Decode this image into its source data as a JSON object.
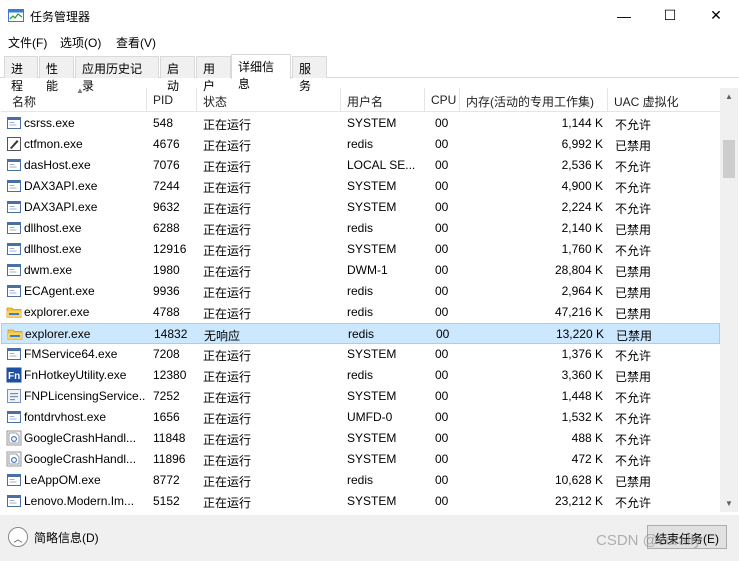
{
  "window": {
    "title": "任务管理器",
    "minimize": "—",
    "maximize": "☐",
    "close": "✕"
  },
  "menu": [
    "文件(F)",
    "选项(O)",
    "查看(V)"
  ],
  "tabs": [
    "进程",
    "性能",
    "应用历史记录",
    "启动",
    "用户",
    "详细信息",
    "服务"
  ],
  "active_tab": "详细信息",
  "columns": [
    "名称",
    "PID",
    "状态",
    "用户名",
    "CPU",
    "内存(活动的专用工作集)",
    "UAC 虚拟化"
  ],
  "rows": [
    {
      "name": "csrss.exe",
      "pid": "548",
      "status": "正在运行",
      "user": "SYSTEM",
      "cpu": "00",
      "mem": "1,144 K",
      "uac": "不允许",
      "icon": "generic-exe-icon"
    },
    {
      "name": "ctfmon.exe",
      "pid": "4676",
      "status": "正在运行",
      "user": "redis",
      "cpu": "00",
      "mem": "6,992 K",
      "uac": "已禁用",
      "icon": "pen-icon"
    },
    {
      "name": "dasHost.exe",
      "pid": "7076",
      "status": "正在运行",
      "user": "LOCAL SE...",
      "cpu": "00",
      "mem": "2,536 K",
      "uac": "不允许",
      "icon": "generic-exe-icon"
    },
    {
      "name": "DAX3API.exe",
      "pid": "7244",
      "status": "正在运行",
      "user": "SYSTEM",
      "cpu": "00",
      "mem": "4,900 K",
      "uac": "不允许",
      "icon": "generic-exe-icon"
    },
    {
      "name": "DAX3API.exe",
      "pid": "9632",
      "status": "正在运行",
      "user": "SYSTEM",
      "cpu": "00",
      "mem": "2,224 K",
      "uac": "不允许",
      "icon": "generic-exe-icon"
    },
    {
      "name": "dllhost.exe",
      "pid": "6288",
      "status": "正在运行",
      "user": "redis",
      "cpu": "00",
      "mem": "2,140 K",
      "uac": "已禁用",
      "icon": "generic-exe-icon"
    },
    {
      "name": "dllhost.exe",
      "pid": "12916",
      "status": "正在运行",
      "user": "SYSTEM",
      "cpu": "00",
      "mem": "1,760 K",
      "uac": "不允许",
      "icon": "generic-exe-icon"
    },
    {
      "name": "dwm.exe",
      "pid": "1980",
      "status": "正在运行",
      "user": "DWM-1",
      "cpu": "00",
      "mem": "28,804 K",
      "uac": "已禁用",
      "icon": "generic-exe-icon"
    },
    {
      "name": "ECAgent.exe",
      "pid": "9936",
      "status": "正在运行",
      "user": "redis",
      "cpu": "00",
      "mem": "2,964 K",
      "uac": "已禁用",
      "icon": "generic-exe-icon"
    },
    {
      "name": "explorer.exe",
      "pid": "4788",
      "status": "正在运行",
      "user": "redis",
      "cpu": "00",
      "mem": "47,216 K",
      "uac": "已禁用",
      "icon": "folder-icon"
    },
    {
      "name": "explorer.exe",
      "pid": "14832",
      "status": "无响应",
      "user": "redis",
      "cpu": "00",
      "mem": "13,220 K",
      "uac": "已禁用",
      "icon": "folder-icon",
      "selected": true
    },
    {
      "name": "FMService64.exe",
      "pid": "7208",
      "status": "正在运行",
      "user": "SYSTEM",
      "cpu": "00",
      "mem": "1,376 K",
      "uac": "不允许",
      "icon": "generic-exe-icon"
    },
    {
      "name": "FnHotkeyUtility.exe",
      "pid": "12380",
      "status": "正在运行",
      "user": "redis",
      "cpu": "00",
      "mem": "3,360 K",
      "uac": "已禁用",
      "icon": "fn-icon"
    },
    {
      "name": "FNPLicensingService...",
      "pid": "7252",
      "status": "正在运行",
      "user": "SYSTEM",
      "cpu": "00",
      "mem": "1,448 K",
      "uac": "不允许",
      "icon": "license-icon"
    },
    {
      "name": "fontdrvhost.exe",
      "pid": "1656",
      "status": "正在运行",
      "user": "UMFD-0",
      "cpu": "00",
      "mem": "1,532 K",
      "uac": "不允许",
      "icon": "generic-exe-icon"
    },
    {
      "name": "GoogleCrashHandl...",
      "pid": "11848",
      "status": "正在运行",
      "user": "SYSTEM",
      "cpu": "00",
      "mem": "488 K",
      "uac": "不允许",
      "icon": "google-icon"
    },
    {
      "name": "GoogleCrashHandl...",
      "pid": "11896",
      "status": "正在运行",
      "user": "SYSTEM",
      "cpu": "00",
      "mem": "472 K",
      "uac": "不允许",
      "icon": "google-icon"
    },
    {
      "name": "LeAppOM.exe",
      "pid": "8772",
      "status": "正在运行",
      "user": "redis",
      "cpu": "00",
      "mem": "10,628 K",
      "uac": "已禁用",
      "icon": "generic-exe-icon"
    },
    {
      "name": "Lenovo.Modern.Im...",
      "pid": "5152",
      "status": "正在运行",
      "user": "SYSTEM",
      "cpu": "00",
      "mem": "23,212 K",
      "uac": "不允许",
      "icon": "generic-exe-icon"
    }
  ],
  "footer": {
    "fewer_details": "简略信息(D)",
    "end_task": "结束任务(E)",
    "watermark": "CSDN @corally"
  },
  "colors": {
    "selected_bg": "#cce8ff",
    "selected_border": "#99d1ff",
    "grid_line": "#e5e5e5"
  }
}
